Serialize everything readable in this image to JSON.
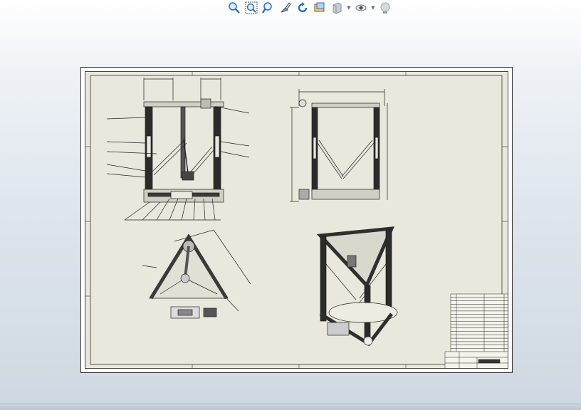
{
  "toolbar": {
    "tools": [
      {
        "name": "zoom-to-fit-icon"
      },
      {
        "name": "zoom-to-area-icon"
      },
      {
        "name": "zoom-in-out-icon"
      },
      {
        "name": "select-icon"
      },
      {
        "name": "rotate-view-icon"
      },
      {
        "name": "pan-icon"
      },
      {
        "name": "display-style-icon"
      },
      {
        "name": "hide-show-items-icon"
      },
      {
        "name": "appearance-icon"
      }
    ]
  },
  "drawing": {
    "views": [
      "front-view",
      "right-view",
      "top-view",
      "isometric-view"
    ],
    "bom_rows": 17,
    "colors": {
      "sheet": "#e8e8dc",
      "ink": "#222222",
      "frame_dark": "#2b2b2b"
    }
  }
}
